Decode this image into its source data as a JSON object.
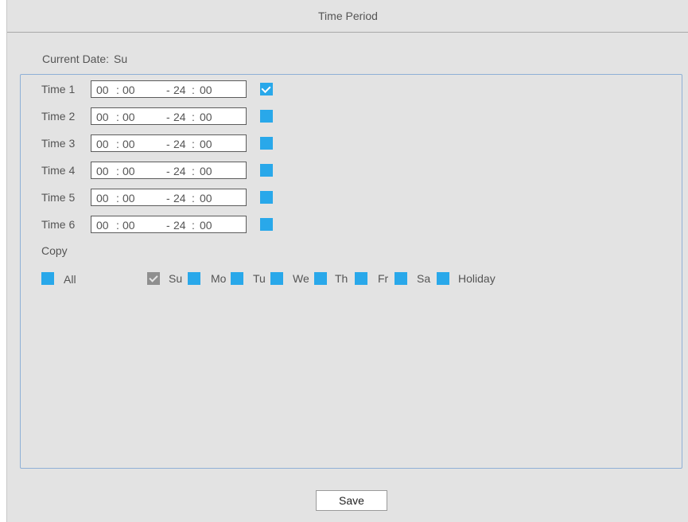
{
  "dialog": {
    "title": "Time Period"
  },
  "current_date": {
    "label": "Current Date:",
    "value": "Su"
  },
  "time_periods": [
    {
      "label": "Time 1",
      "start_h": "00",
      "start_m": "00",
      "end_h": "24",
      "end_m": "00",
      "enabled": true
    },
    {
      "label": "Time 2",
      "start_h": "00",
      "start_m": "00",
      "end_h": "24",
      "end_m": "00",
      "enabled": false
    },
    {
      "label": "Time 3",
      "start_h": "00",
      "start_m": "00",
      "end_h": "24",
      "end_m": "00",
      "enabled": false
    },
    {
      "label": "Time 4",
      "start_h": "00",
      "start_m": "00",
      "end_h": "24",
      "end_m": "00",
      "enabled": false
    },
    {
      "label": "Time 5",
      "start_h": "00",
      "start_m": "00",
      "end_h": "24",
      "end_m": "00",
      "enabled": false
    },
    {
      "label": "Time 6",
      "start_h": "00",
      "start_m": "00",
      "end_h": "24",
      "end_m": "00",
      "enabled": false
    }
  ],
  "separators": {
    "colon": ":",
    "dash": "-"
  },
  "copy": {
    "label": "Copy",
    "all_label": "All",
    "all_checked": false,
    "days": [
      {
        "label": "Su",
        "checked": true,
        "disabled": true
      },
      {
        "label": "Mo",
        "checked": false,
        "disabled": false
      },
      {
        "label": "Tu",
        "checked": false,
        "disabled": false
      },
      {
        "label": "We",
        "checked": false,
        "disabled": false
      },
      {
        "label": "Th",
        "checked": false,
        "disabled": false
      },
      {
        "label": "Fr",
        "checked": false,
        "disabled": false
      },
      {
        "label": "Sa",
        "checked": false,
        "disabled": false
      },
      {
        "label": "Holiday",
        "checked": false,
        "disabled": false
      }
    ]
  },
  "footer": {
    "save_label": "Save"
  },
  "colors": {
    "checkbox_blue": "#29a8ea",
    "checkbox_disabled": "#8f8f8f",
    "panel_border": "#8fb0d6",
    "background": "#e3e3e3"
  }
}
